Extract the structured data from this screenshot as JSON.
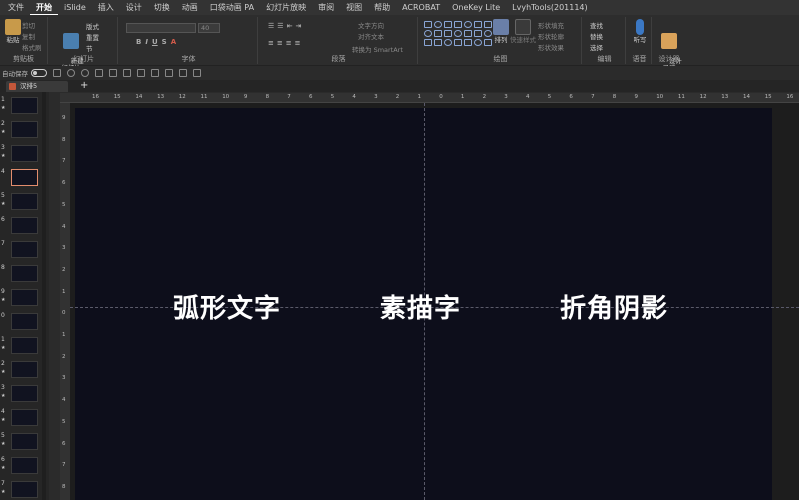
{
  "menu": [
    "文件",
    "开始",
    "iSlide",
    "插入",
    "设计",
    "切换",
    "动画",
    "口袋动画 PA",
    "幻灯片放映",
    "审阅",
    "视图",
    "帮助",
    "ACROBAT",
    "OneKey Lite",
    "LvyhTools(201114)"
  ],
  "menu_active_index": 1,
  "ribbon": {
    "paste": "粘贴",
    "cut": "剪切",
    "copy": "复制",
    "format_painter": "格式刷",
    "new_slide": "新建\n幻灯片",
    "layout": "版式",
    "reset": "重置",
    "section": "节",
    "font_size": "40",
    "text_direction": "文字方向",
    "align_text": "对齐文本",
    "smartart": "转换为 SmartArt",
    "arrange": "排列",
    "quick_styles": "快速样式",
    "shape_fill": "形状填充",
    "shape_outline": "形状轮廓",
    "shape_effects": "形状效果",
    "find": "查找",
    "replace": "替换",
    "select": "选择",
    "dictate": "听写",
    "designer": "设计\n灵感",
    "groups": {
      "clipboard": "剪贴板",
      "slides": "幻灯片",
      "font": "字体",
      "paragraph": "段落",
      "drawing": "绘图",
      "editing": "编辑",
      "voice": "语音",
      "designer": "设计器"
    }
  },
  "qat": {
    "autosave": "自动保存"
  },
  "doc_tab": "汉排5",
  "thumbnails": [
    {
      "num": "1",
      "star": "★"
    },
    {
      "num": "2",
      "star": "★"
    },
    {
      "num": "3",
      "star": "★"
    },
    {
      "num": "4",
      "star": ""
    },
    {
      "num": "5",
      "star": "★"
    },
    {
      "num": "6",
      "star": ""
    },
    {
      "num": "7",
      "star": ""
    },
    {
      "num": "8",
      "star": ""
    },
    {
      "num": "9",
      "star": "★"
    },
    {
      "num": "0",
      "star": ""
    },
    {
      "num": "1",
      "star": "★"
    },
    {
      "num": "2",
      "star": "★"
    },
    {
      "num": "3",
      "star": "★"
    },
    {
      "num": "4",
      "star": "★"
    },
    {
      "num": "5",
      "star": "★"
    },
    {
      "num": "6",
      "star": "★"
    },
    {
      "num": "7",
      "star": "★"
    }
  ],
  "selected_thumbnail": 3,
  "ruler_h": [
    "16",
    "15",
    "14",
    "13",
    "12",
    "11",
    "10",
    "9",
    "8",
    "7",
    "6",
    "5",
    "4",
    "3",
    "2",
    "1",
    "0",
    "1",
    "2",
    "3",
    "4",
    "5",
    "6",
    "7",
    "8",
    "9",
    "10",
    "11",
    "12",
    "13",
    "14",
    "15",
    "16"
  ],
  "ruler_v": [
    "9",
    "8",
    "7",
    "6",
    "5",
    "4",
    "3",
    "2",
    "1",
    "0",
    "1",
    "2",
    "3",
    "4",
    "5",
    "6",
    "7",
    "8"
  ],
  "slide": {
    "text_left": "弧形文字",
    "text_center": "素描字",
    "text_right": "折角阴影",
    "background": "#0d0e1b"
  }
}
